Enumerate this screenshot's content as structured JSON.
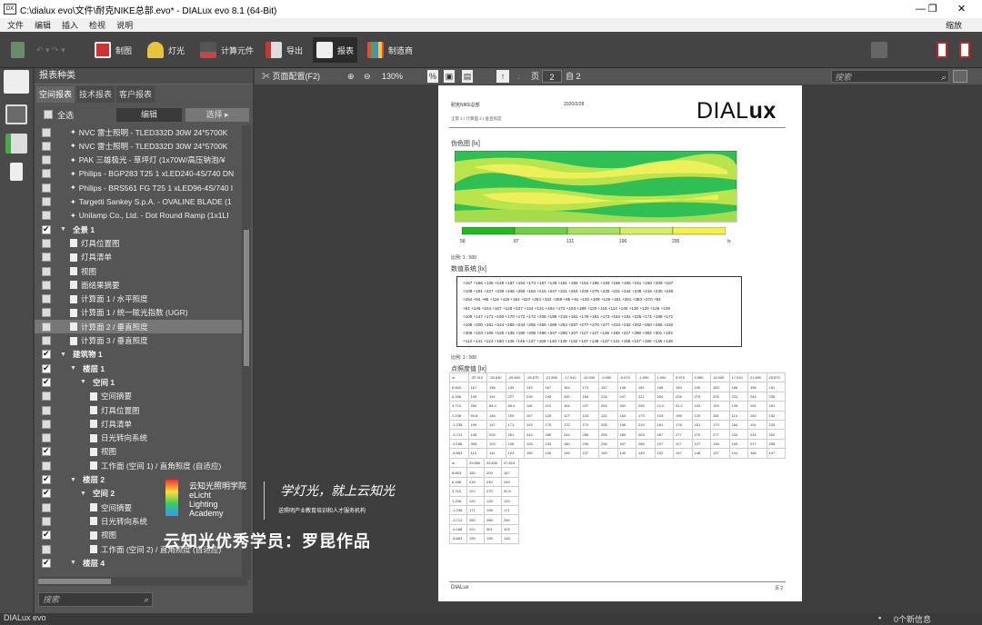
{
  "window": {
    "title": "C:\\dialux evo\\文件\\耐克NIKE总部.evo* - DIALux evo 8.1  (64-Bit)",
    "minimize": "—",
    "maximize": "❐",
    "close": "✕"
  },
  "menu": {
    "items": [
      "文件",
      "编辑",
      "插入",
      "检视",
      "说明"
    ],
    "zoom": "缩放"
  },
  "ribbon": {
    "items": [
      "制图",
      "灯光",
      "计算元件",
      "导出",
      "报表",
      "制造商"
    ],
    "active": "报表"
  },
  "panel": {
    "title": "报表种类",
    "tabs": [
      "空间报表",
      "技术报表",
      "客户报表"
    ],
    "select_all": "全选",
    "edit": "编辑",
    "choose": "选择",
    "search_placeholder": "搜索",
    "tree": [
      {
        "label": "NVC 雷士照明 - TLED332D 30W 24°5700K",
        "checked": false,
        "level": 2,
        "kind": "lamp"
      },
      {
        "label": "NVC 雷士照明 - TLED332D 30W 24°5700K",
        "checked": false,
        "level": 2,
        "kind": "lamp"
      },
      {
        "label": "PAK 三雄极光 - 草坪灯 (1x70W/高压钠泡/¥",
        "checked": false,
        "level": 2,
        "kind": "lamp"
      },
      {
        "label": "Philips - BGP283 T25 1 xLED240-4S/740 DN",
        "checked": false,
        "level": 2,
        "kind": "lamp"
      },
      {
        "label": "Philips - BRS561 FG T25 1 xLED96-4S/740 I",
        "checked": false,
        "level": 2,
        "kind": "lamp"
      },
      {
        "label": "Targetti Sankey S.p.A. - OVALINE BLADE (1",
        "checked": false,
        "level": 2,
        "kind": "lamp"
      },
      {
        "label": "Unilamp Co., Ltd. - Dot Round Ramp (1x1LI",
        "checked": false,
        "level": 2,
        "kind": "lamp"
      },
      {
        "label": "全景 1",
        "checked": true,
        "level": 1,
        "kind": "group"
      },
      {
        "label": "灯具位置图",
        "checked": false,
        "level": 2,
        "kind": "doc"
      },
      {
        "label": "灯具清单",
        "checked": false,
        "level": 2,
        "kind": "doc"
      },
      {
        "label": "视图",
        "checked": false,
        "level": 2,
        "kind": "doc"
      },
      {
        "label": "面结果摘要",
        "checked": false,
        "level": 2,
        "kind": "doc"
      },
      {
        "label": "计算面 1 / 水平照度",
        "checked": false,
        "level": 2,
        "kind": "doc"
      },
      {
        "label": "计算面 1 / 统一眩光指数 (UGR)",
        "checked": false,
        "level": 2,
        "kind": "doc"
      },
      {
        "label": "计算面 2 / 垂直照度",
        "checked": false,
        "level": 2,
        "kind": "doc",
        "selected": true
      },
      {
        "label": "计算面 3 / 垂直照度",
        "checked": false,
        "level": 2,
        "kind": "doc"
      },
      {
        "label": "建筑物 1",
        "checked": true,
        "level": 1,
        "kind": "group"
      },
      {
        "label": "楼层 1",
        "checked": true,
        "level": 2,
        "kind": "group"
      },
      {
        "label": "空间 1",
        "checked": true,
        "level": 3,
        "kind": "group"
      },
      {
        "label": "空间摘要",
        "checked": false,
        "level": 4,
        "kind": "doc"
      },
      {
        "label": "灯具位置图",
        "checked": false,
        "level": 4,
        "kind": "doc"
      },
      {
        "label": "灯具清单",
        "checked": false,
        "level": 4,
        "kind": "doc"
      },
      {
        "label": "日光转向系统",
        "checked": false,
        "level": 4,
        "kind": "doc"
      },
      {
        "label": "视图",
        "checked": true,
        "level": 4,
        "kind": "doc"
      },
      {
        "label": "工作面 (空间 1) / 直角照度 (自适应)",
        "checked": false,
        "level": 4,
        "kind": "doc"
      },
      {
        "label": "楼层 2",
        "checked": true,
        "level": 2,
        "kind": "group"
      },
      {
        "label": "空间 2",
        "checked": true,
        "level": 3,
        "kind": "group"
      },
      {
        "label": "空间摘要",
        "checked": false,
        "level": 4,
        "kind": "doc"
      },
      {
        "label": "日光转向系统",
        "checked": false,
        "level": 4,
        "kind": "doc"
      },
      {
        "label": "视图",
        "checked": true,
        "level": 4,
        "kind": "doc"
      },
      {
        "label": "工作面 (空间 2) / 直角照度 (自适应)",
        "checked": false,
        "level": 4,
        "kind": "doc"
      },
      {
        "label": "楼层 4",
        "checked": true,
        "level": 2,
        "kind": "group"
      }
    ]
  },
  "doc_toolbar": {
    "page_config": "页面配置(F2)",
    "zoom": "130%",
    "page_label": "页",
    "page_value": "2",
    "of_label": "自 2",
    "search_placeholder": "搜索"
  },
  "report": {
    "project": "耐克NIKE总部",
    "date": "2020/2/28",
    "breadcrumb": "全景 1 / 计算面 2 / 垂直照度",
    "brand": "DIALux",
    "falsecolor_title": "伪色图 [lx]",
    "legend": [
      "58",
      "87",
      "131",
      "196",
      "295",
      "lx"
    ],
    "scale1": "比例: 1 : 500",
    "grid_title": "数值系统 [lx]",
    "scale2": "比例: 1 : 500",
    "table_title": "点照度值 [lx]",
    "footer_brand": "DIALux",
    "page_no": "页 2",
    "table_header": [
      "m",
      "-37.910",
      "-33.830",
      "-29.800",
      "-25.870",
      "-21.890",
      "-17.910",
      "-13.930",
      "-9.950",
      "-5.970",
      "-1.990",
      "1.990",
      "5.970",
      "9.950",
      "13.930",
      "17.910",
      "21.890",
      "25.870"
    ],
    "table_rows": [
      [
        "8.663",
        "167",
        "156",
        "139",
        "149",
        "167",
        "164",
        "174",
        "157",
        "148",
        "181",
        "166",
        "154",
        "195",
        "183",
        "166",
        "156",
        "151"
      ],
      [
        "6.188",
        "109",
        "191",
        "227",
        "239",
        "245",
        "250",
        "184",
        "216",
        "247",
        "221",
        "254",
        "226",
        "275",
        "225",
        "231",
        "244",
        "239"
      ],
      [
        "3.713",
        "254",
        "84.4",
        "85.4",
        "116",
        "119",
        "164",
        "227",
        "254",
        "342",
        "259",
        "84.6",
        "91.2",
        "103",
        "109",
        "149",
        "191",
        "281"
      ],
      [
        "1.238",
        "90.8",
        "146",
        "104",
        "167",
        "125",
        "127",
        "124",
        "131",
        "164",
        "173",
        "103",
        "198",
        "120",
        "116",
        "114",
        "140",
        "130"
      ],
      [
        "-1.238",
        "109",
        "147",
        "171",
        "193",
        "170",
        "172",
        "172",
        "206",
        "196",
        "219",
        "181",
        "176",
        "181",
        "173",
        "164",
        "191",
        "225"
      ],
      [
        "-3.713",
        "108",
        "200",
        "261",
        "244",
        "265",
        "244",
        "265",
        "259",
        "269",
        "263",
        "287",
        "277",
        "270",
        "277",
        "234",
        "232",
        "252"
      ],
      [
        "-6.188",
        "305",
        "103",
        "106",
        "126",
        "135",
        "180",
        "206",
        "296",
        "347",
        "285",
        "107",
        "117",
        "127",
        "136",
        "169",
        "217",
        "298"
      ],
      [
        "-8.663",
        "113",
        "141",
        "124",
        "150",
        "136",
        "145",
        "137",
        "169",
        "140",
        "149",
        "132",
        "147",
        "148",
        "137",
        "141",
        "166",
        "147"
      ]
    ],
    "table2_header": [
      "m",
      "29.850",
      "33.830",
      "37.810"
    ],
    "table2_rows": [
      [
        "8.663",
        "150",
        "209",
        "167"
      ],
      [
        "6.188",
        "216",
        "230",
        "249"
      ],
      [
        "3.713",
        "383",
        "270",
        "91.6"
      ],
      [
        "1.238",
        "120",
        "126",
        "129"
      ],
      [
        "-1.238",
        "171",
        "198",
        "171"
      ],
      [
        "-3.713",
        "250",
        "286",
        "240"
      ],
      [
        "-6.188",
        "383",
        "301",
        "103"
      ],
      [
        "-8.663",
        "159",
        "135",
        "148"
      ]
    ]
  },
  "watermark": {
    "logo_line1": "云知光照明学院",
    "logo_line2": "eLicht",
    "logo_line3": "Lighting",
    "logo_line4": "Academy",
    "slogan": "学灯光，就上云知光",
    "slogan_sub": "送照明产业教育培训和人才服务机构",
    "credit": "云知光优秀学员：罗昆作品"
  },
  "status": {
    "app": "DIALux evo",
    "messages": "0个新信息"
  }
}
